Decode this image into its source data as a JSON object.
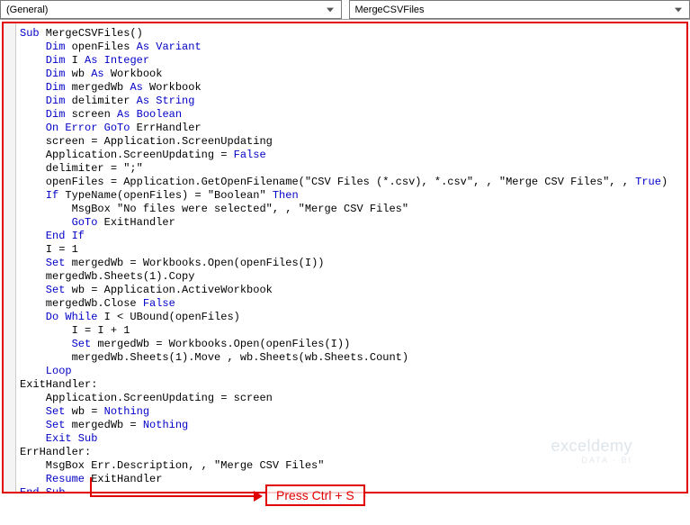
{
  "dropdowns": {
    "object": "(General)",
    "procedure": "MergeCSVFiles"
  },
  "code": {
    "l01a": "Sub",
    "l01b": " MergeCSVFiles()",
    "l02a": "    Dim",
    "l02b": " openFiles ",
    "l02c": "As Variant",
    "l03a": "    Dim",
    "l03b": " I ",
    "l03c": "As Integer",
    "l04a": "    Dim",
    "l04b": " wb ",
    "l04c": "As",
    "l04d": " Workbook",
    "l05a": "    Dim",
    "l05b": " mergedWb ",
    "l05c": "As",
    "l05d": " Workbook",
    "l06a": "    Dim",
    "l06b": " delimiter ",
    "l06c": "As String",
    "l07a": "    Dim",
    "l07b": " screen ",
    "l07c": "As Boolean",
    "l08a": "    On Error GoTo",
    "l08b": " ErrHandler",
    "l09": "    screen = Application.ScreenUpdating",
    "l10a": "    Application.ScreenUpdating = ",
    "l10b": "False",
    "l11": "    delimiter = \";\"",
    "l12a": "    openFiles = Application.GetOpenFilename(\"CSV Files (*.csv), *.csv\", , \"Merge CSV Files\", , ",
    "l12b": "True",
    "l12c": ")",
    "l13a": "    If",
    "l13b": " TypeName(openFiles) = \"Boolean\" ",
    "l13c": "Then",
    "l14": "        MsgBox \"No files were selected\", , \"Merge CSV Files\"",
    "l15a": "        GoTo",
    "l15b": " ExitHandler",
    "l16": "    End If",
    "l17": "    I = 1",
    "l18a": "    Set",
    "l18b": " mergedWb = Workbooks.Open(openFiles(I))",
    "l19": "    mergedWb.Sheets(1).Copy",
    "l20a": "    Set",
    "l20b": " wb = Application.ActiveWorkbook",
    "l21a": "    mergedWb.Close ",
    "l21b": "False",
    "l22a": "    Do While",
    "l22b": " I < UBound(openFiles)",
    "l23": "        I = I + 1",
    "l24a": "        Set",
    "l24b": " mergedWb = Workbooks.Open(openFiles(I))",
    "l25": "        mergedWb.Sheets(1).Move , wb.Sheets(wb.Sheets.Count)",
    "l26": "    Loop",
    "l27": "ExitHandler:",
    "l28": "    Application.ScreenUpdating = screen",
    "l29a": "    Set",
    "l29b": " wb = ",
    "l29c": "Nothing",
    "l30a": "    Set",
    "l30b": " mergedWb = ",
    "l30c": "Nothing",
    "l31": "    Exit Sub",
    "l32": "ErrHandler:",
    "l33": "    MsgBox Err.Description, , \"Merge CSV Files\"",
    "l34a": "    Resume",
    "l34b": " ExitHandler",
    "l35": "End Sub"
  },
  "annotation": "Press Ctrl + S",
  "watermark": {
    "main": "exceldemy",
    "sub": "DATA · BI"
  }
}
